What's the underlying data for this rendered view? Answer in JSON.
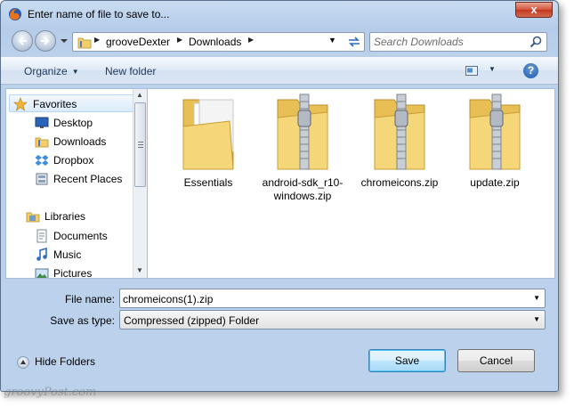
{
  "window": {
    "title": "Enter name of file to save to...",
    "close_label": "x",
    "icon": "firefox-icon"
  },
  "address_bar": {
    "breadcrumbs": [
      "grooveDexter",
      "Downloads"
    ],
    "search_placeholder": "Search Downloads"
  },
  "toolbar": {
    "organize_label": "Organize",
    "new_folder_label": "New folder",
    "help_label": "?"
  },
  "nav_pane": {
    "groups": [
      {
        "label": "Favorites",
        "icon": "star-icon",
        "items": [
          {
            "label": "Desktop",
            "icon": "desktop-icon"
          },
          {
            "label": "Downloads",
            "icon": "downloads-folder-icon"
          },
          {
            "label": "Dropbox",
            "icon": "dropbox-icon"
          },
          {
            "label": "Recent Places",
            "icon": "recent-places-icon"
          }
        ]
      },
      {
        "label": "Libraries",
        "icon": "libraries-icon",
        "items": [
          {
            "label": "Documents",
            "icon": "documents-icon"
          },
          {
            "label": "Music",
            "icon": "music-icon"
          },
          {
            "label": "Pictures",
            "icon": "pictures-icon"
          }
        ]
      }
    ]
  },
  "files": [
    {
      "name": "Essentials",
      "icon": "folder-icon"
    },
    {
      "name": "android-sdk_r10-windows.zip",
      "icon": "zip-folder-icon"
    },
    {
      "name": "chromeicons.zip",
      "icon": "zip-folder-icon"
    },
    {
      "name": "update.zip",
      "icon": "zip-folder-icon"
    }
  ],
  "form": {
    "file_name_label": "File name:",
    "file_name_value": "chromeicons(1).zip",
    "save_type_label": "Save as type:",
    "save_type_value": "Compressed (zipped) Folder"
  },
  "footer": {
    "hide_folders_label": "Hide Folders",
    "save_label": "Save",
    "cancel_label": "Cancel"
  },
  "watermark": "groovyPost.com",
  "colors": {
    "frame": "#bcd2ec",
    "folder": "#f2cf6a",
    "selected_highlight": "#dbebfc"
  }
}
